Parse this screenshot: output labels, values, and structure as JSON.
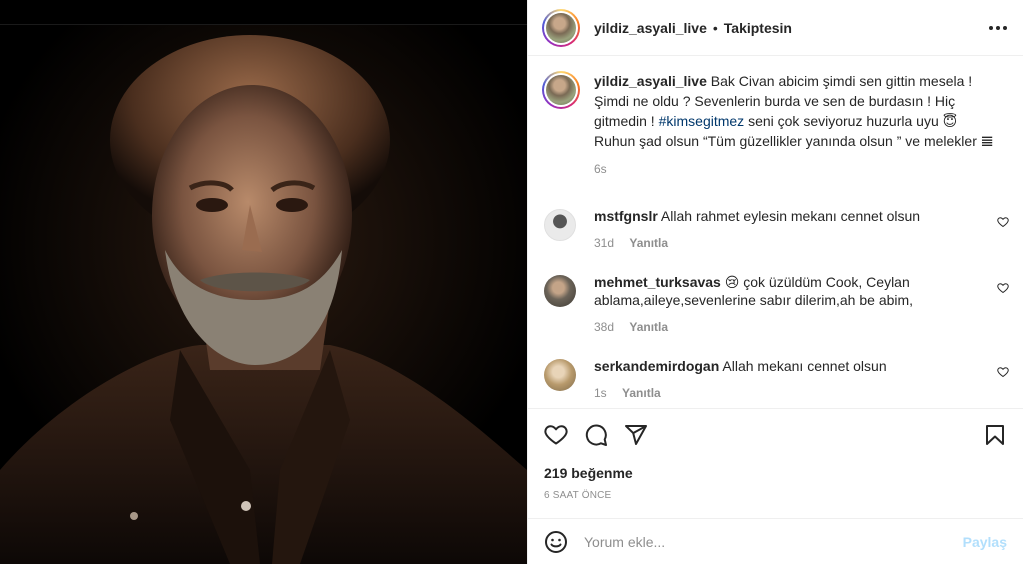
{
  "post": {
    "username": "yildiz_asyali_live",
    "separator": "•",
    "follow_status": "Takiptesin"
  },
  "caption": {
    "username": "yildiz_asyali_live",
    "text_part1": "Bak Civan abicim şimdi sen gittin mesela ! Şimdi ne oldu ? Sevenlerin burda ve sen de burdasın ! Hiç gitmedin ! ",
    "hashtag": "#kimsegitmez",
    "text_part2": " seni çok seviyoruz huzurla uyu 😇 Ruhun şad olsun “Tüm güzellikler yanında olsun ” ve melekler 𝌆",
    "time": "6s"
  },
  "comments": [
    {
      "username": "mstfgnslr",
      "text": "Allah rahmet eylesin mekanı cennet olsun",
      "time": "31d",
      "reply_label": "Yanıtla",
      "avatar_color": "#d9d9d9"
    },
    {
      "username": "mehmet_turksavas",
      "text": "😢 çok üzüldüm Cook, Ceylan ablama,aileye,sevenlerine sabır dilerim,ah be abim,",
      "time": "38d",
      "reply_label": "Yanıtla",
      "avatar_color": "#6b6358"
    },
    {
      "username": "serkandemirdogan",
      "text": "Allah mekanı cennet olsun",
      "time": "1s",
      "reply_label": "Yanıtla",
      "avatar_color": "#b89a6c"
    }
  ],
  "actions": {
    "like_icon": "heart-icon",
    "comment_icon": "comment-icon",
    "share_icon": "paper-plane-icon",
    "save_icon": "bookmark-icon"
  },
  "likes": "219 beğenme",
  "posted_ago": "6 SAAT ÖNCE",
  "add_comment": {
    "placeholder": "Yorum ekle...",
    "post_label": "Paylaş"
  },
  "colors": {
    "link": "#00376b",
    "muted": "#8e8e8e",
    "post_disabled": "#b2dffc"
  }
}
